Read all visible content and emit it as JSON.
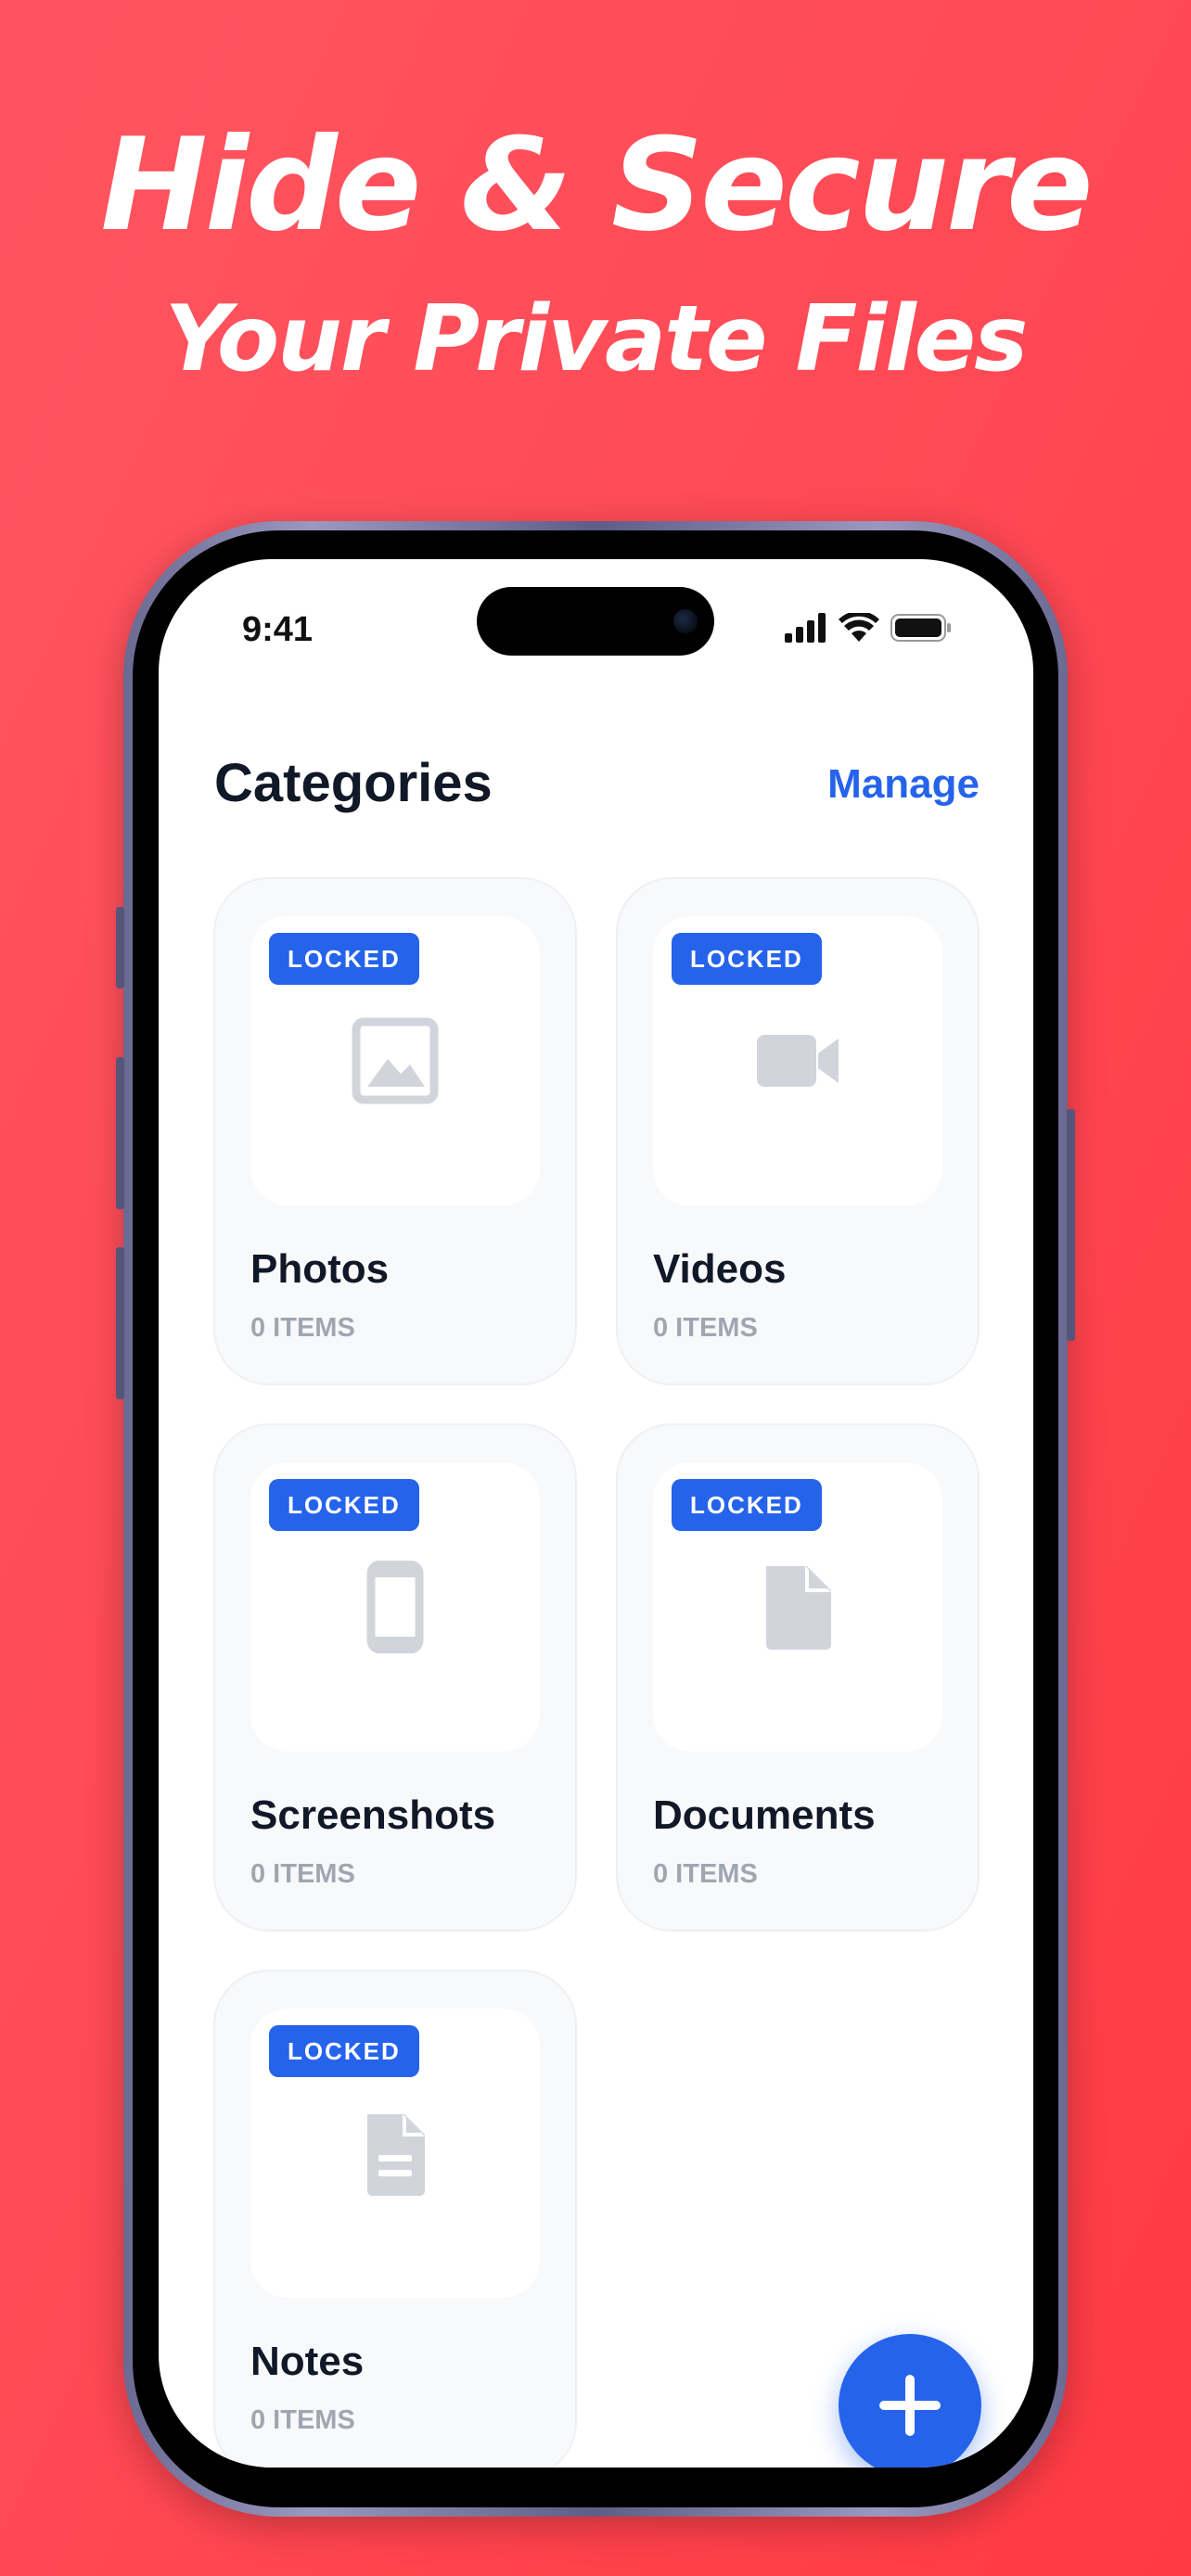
{
  "headline": {
    "line1": "Hide & Secure",
    "line2": "Your Private Files"
  },
  "status_bar": {
    "time": "9:41"
  },
  "header": {
    "title": "Categories",
    "manage_label": "Manage"
  },
  "categories": [
    {
      "name": "Photos",
      "count": "0 ITEMS",
      "badge": "LOCKED",
      "icon": "image-icon"
    },
    {
      "name": "Videos",
      "count": "0 ITEMS",
      "badge": "LOCKED",
      "icon": "video-camera-icon"
    },
    {
      "name": "Screenshots",
      "count": "0 ITEMS",
      "badge": "LOCKED",
      "icon": "phone-icon"
    },
    {
      "name": "Documents",
      "count": "0 ITEMS",
      "badge": "LOCKED",
      "icon": "document-icon"
    },
    {
      "name": "Notes",
      "count": "0 ITEMS",
      "badge": "LOCKED",
      "icon": "note-icon"
    }
  ],
  "fab": {
    "icon": "plus-icon"
  },
  "colors": {
    "background": "#ff4a55",
    "accent": "#2563eb",
    "icon_gray": "#d1d5db"
  }
}
